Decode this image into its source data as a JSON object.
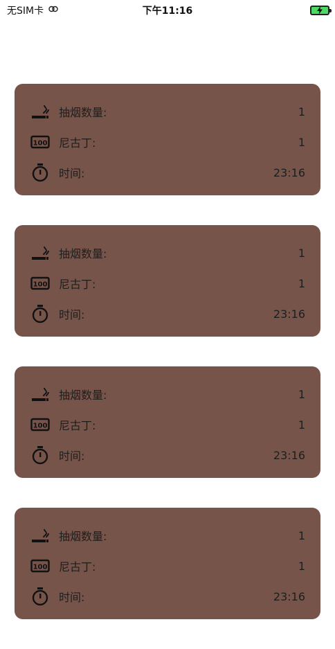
{
  "status_bar": {
    "carrier": "无SIM卡",
    "time": "下午11:16"
  },
  "records": [
    {
      "cigarettes_label": "抽烟数量:",
      "cigarettes_value": "1",
      "nicotine_label": "尼古丁:",
      "nicotine_value": "1",
      "time_label": "时间:",
      "time_value": "23:16"
    },
    {
      "cigarettes_label": "抽烟数量:",
      "cigarettes_value": "1",
      "nicotine_label": "尼古丁:",
      "nicotine_value": "1",
      "time_label": "时间:",
      "time_value": "23:16"
    },
    {
      "cigarettes_label": "抽烟数量:",
      "cigarettes_value": "1",
      "nicotine_label": "尼古丁:",
      "nicotine_value": "1",
      "time_label": "时间:",
      "time_value": "23:16"
    },
    {
      "cigarettes_label": "抽烟数量:",
      "cigarettes_value": "1",
      "nicotine_label": "尼古丁:",
      "nicotine_value": "1",
      "time_label": "时间:",
      "time_value": "23:16"
    }
  ],
  "colors": {
    "card_background": "#76544a",
    "battery": "#4cd964"
  },
  "icons": {
    "cigarettes": "smoking-icon",
    "nicotine": "nicotine-100-icon",
    "time": "stopwatch-icon"
  }
}
